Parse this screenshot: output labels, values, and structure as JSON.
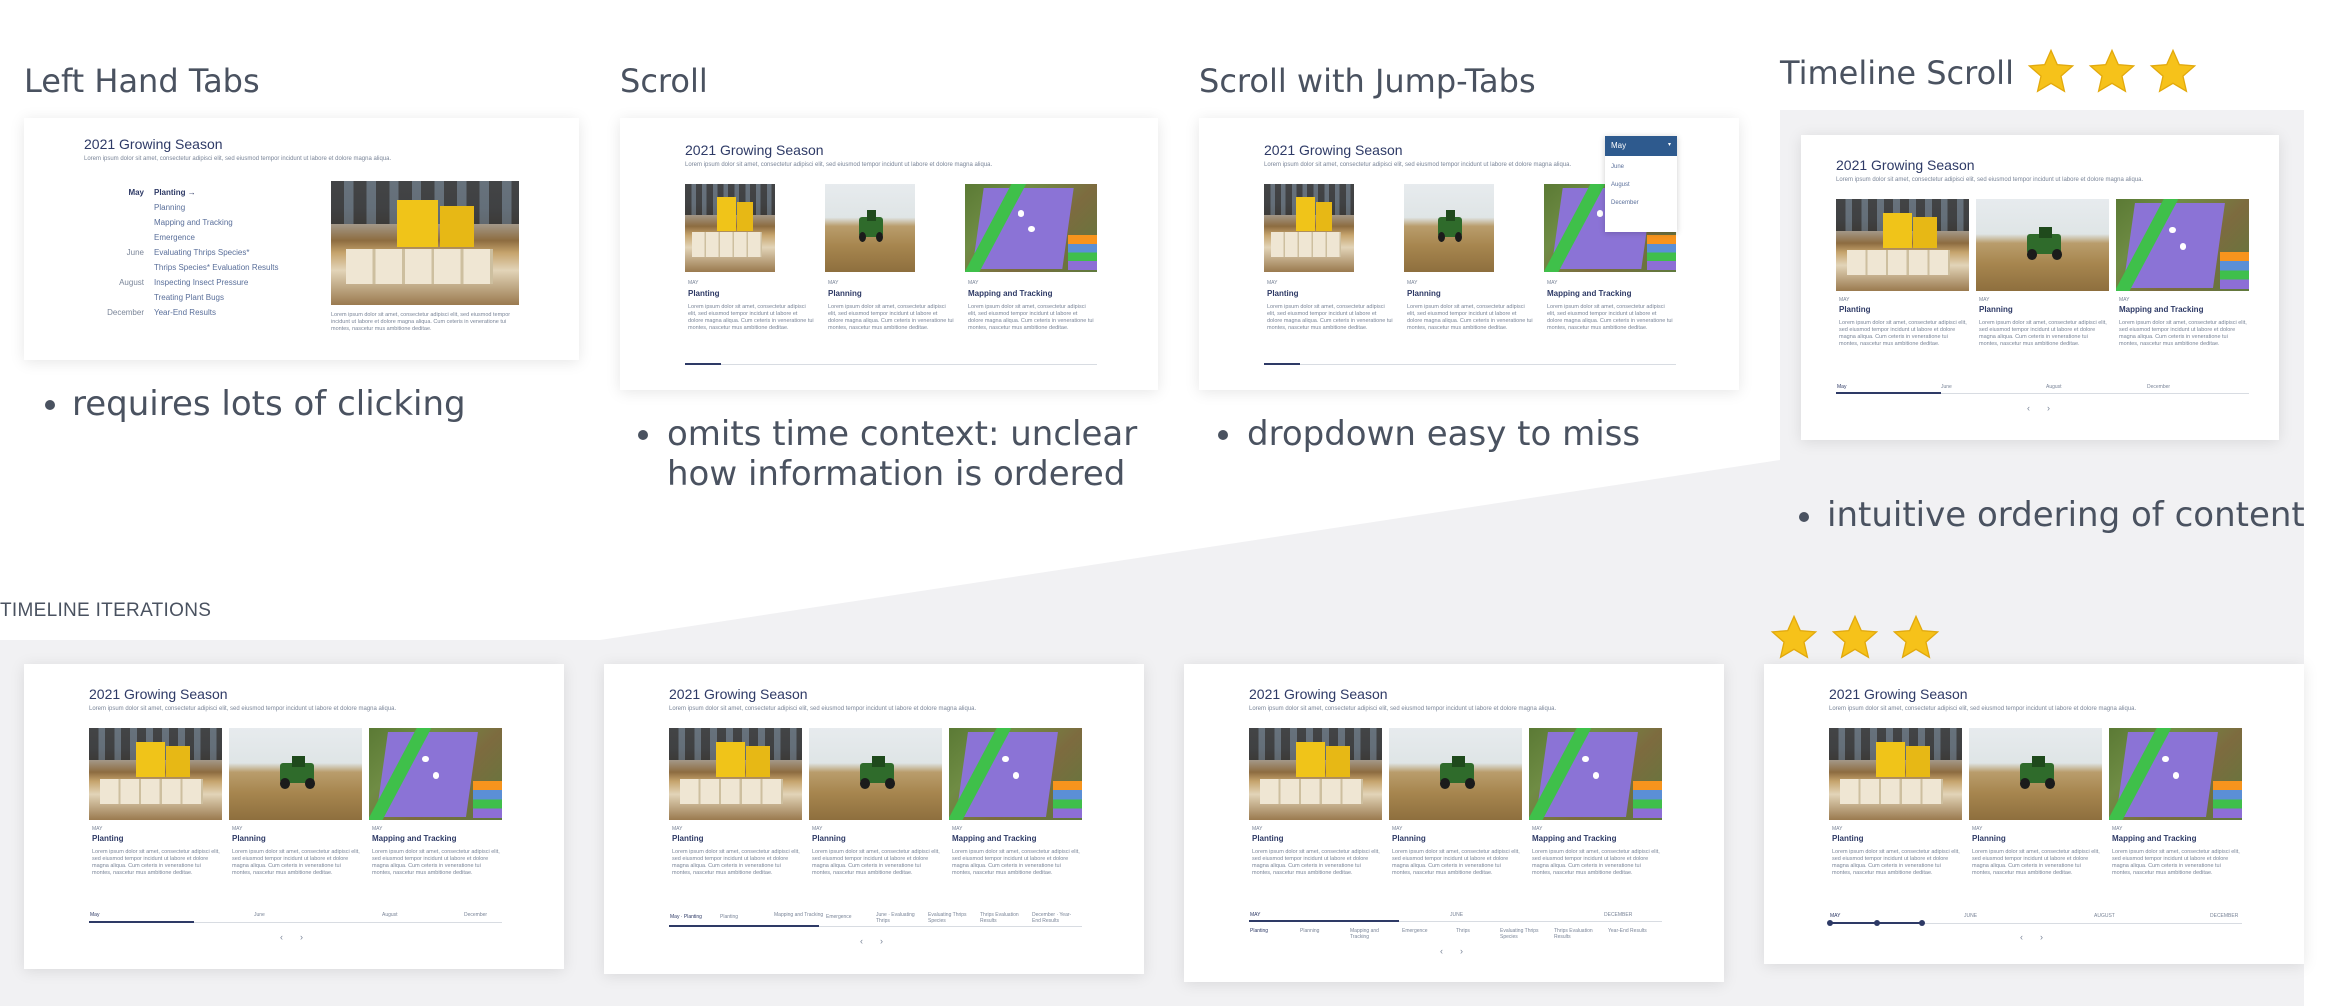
{
  "sections": {
    "left_hand_tabs": {
      "title": "Left Hand Tabs",
      "note": "requires lots of clicking"
    },
    "scroll": {
      "title": "Scroll",
      "note": "omits time context: unclear how information is ordered"
    },
    "scroll_jump": {
      "title": "Scroll with Jump-Tabs",
      "note": "dropdown easy to miss"
    },
    "timeline_scroll": {
      "title": "Timeline Scroll",
      "note": "intuitive ordering of content",
      "stars": 3
    }
  },
  "iterations": {
    "label": "TIMELINE ITERATIONS",
    "final_stars": 3
  },
  "mock": {
    "title": "2021 Growing Season",
    "subtitle": "Lorem ipsum dolor sit amet, consectetur adipisci elit, sed eiusmod tempor incidunt ut labore et dolore magna aliqua.",
    "cards": [
      {
        "month": "May",
        "title": "Planting",
        "text": "Lorem ipsum dolor sit amet, consectetur adipisci elit, sed eiusmod tempor incidunt ut labore et dolore magna aliqua. Cum ceteris in veneratione tui montes, nascetur mus ambitione deditae."
      },
      {
        "month": "May",
        "title": "Planning",
        "text": "Lorem ipsum dolor sit amet, consectetur adipisci elit, sed eiusmod tempor incidunt ut labore et dolore magna aliqua. Cum ceteris in veneratione tui montes, nascetur mus ambitione deditae."
      },
      {
        "month": "May",
        "title": "Mapping and Tracking",
        "text": "Lorem ipsum dolor sit amet, consectetur adipisci elit, sed eiusmod tempor incidunt ut labore et dolore magna aliqua. Cum ceteris in veneratione tui montes, nascetur mus ambitione deditae."
      }
    ],
    "left_tabs": {
      "groups": [
        {
          "month": "May",
          "items": [
            "Planting →",
            "Planning",
            "Mapping and Tracking",
            "Emergence"
          ]
        },
        {
          "month": "June",
          "items": [
            "Evaluating Thrips Species*",
            "Thrips Species* Evaluation Results"
          ]
        },
        {
          "month": "August",
          "items": [
            "Inspecting Insect Pressure",
            "Treating Plant Bugs"
          ]
        },
        {
          "month": "December",
          "items": [
            "Year-End Results"
          ]
        }
      ],
      "caption": "Lorem ipsum dolor sit amet, consectetur adipisci elit, sed eiusmod tempor incidunt ut labore et dolore magna aliqua. Cum ceteris in veneratione tui montes, nascetur mus ambitione deditae."
    },
    "dropdown": {
      "selected": "May",
      "options": [
        "June",
        "August",
        "December"
      ]
    },
    "timeline_months": [
      "May",
      "June",
      "August",
      "December"
    ],
    "iteration2_labels": [
      "May · Planting",
      "Planting",
      "Mapping and Tracking",
      "Emergence",
      "June · Evaluating Thrips",
      "Evaluating Thrips Species",
      "Thrips Evaluation Results",
      "December · Year-End Results"
    ],
    "iteration3_months": [
      "MAY",
      "JUNE",
      "DECEMBER"
    ],
    "iteration3_items": [
      "Planting",
      "Planning",
      "Mapping and Tracking",
      "Emergence",
      "Thrips",
      "Evaluating Thrips Species",
      "Thrips Evaluation Results",
      "Year-End Results"
    ],
    "iteration4_months": [
      "MAY",
      "JUNE",
      "AUGUST",
      "DECEMBER"
    ],
    "nav": {
      "prev": "‹",
      "next": "›"
    }
  }
}
